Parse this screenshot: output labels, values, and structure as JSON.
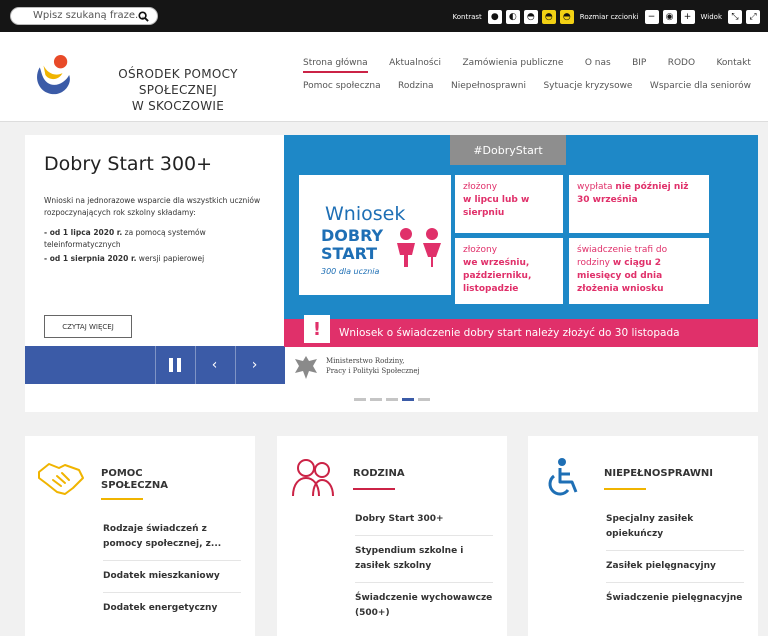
{
  "topbar": {
    "search_placeholder": "Wpisz szukaną fraze...",
    "contrast_label": "Kontrast",
    "font_size_label": "Rozmiar czcionki",
    "view_label": "Widok"
  },
  "header": {
    "org_name_line1": "OŚRODEK POMOCY SPOŁECZNEJ",
    "org_name_line2": "W SKOCZOWIE"
  },
  "nav": {
    "row1": [
      "Strona główna",
      "Aktualności",
      "Zamówienia publiczne",
      "O nas",
      "BIP",
      "RODO",
      "Kontakt"
    ],
    "row2": [
      "Pomoc społeczna",
      "Rodzina",
      "Niepełnosprawni",
      "Sytuacje kryzysowe",
      "Wsparcie dla seniorów"
    ],
    "active": "Strona główna"
  },
  "hero": {
    "title": "Dobry Start 300+",
    "intro": "Wnioski na jednorazowe wsparcie dla wszystkich uczniów rozpoczynających rok szkolny składamy:",
    "item1_bold": "- od 1 lipca 2020 r.",
    "item1_rest": " za pomocą systemów teleinformatycznych",
    "item2_bold": "- od 1 sierpnia 2020 r.",
    "item2_rest": " wersji papierowej",
    "read_more": "CZYTAJ WIĘCEJ"
  },
  "banner": {
    "tag": "#DobryStart",
    "wniosek": "Wniosek",
    "dobry": "DOBRY",
    "start": "START",
    "sub300": "300 dla ucznia",
    "c1_line1": "złożony",
    "c1_bold": "w lipcu lub w sierpniu",
    "c2_line1": "wypłata",
    "c2_bold": "nie później niż 30 września",
    "c3_line1": "złożony",
    "c3_bold": "we wrześniu, październiku, listopadzie",
    "c4_line1": "świadczenie trafi do rodziny",
    "c4_bold": "w ciągu 2 miesięcy od dnia złożenia wniosku",
    "footer": "Wniosek o świadczenie dobry start należy złożyć do 30 listopada",
    "ministry_line1": "Ministerstwo Rodziny,",
    "ministry_line2": "Pracy i Polityki Społecznej"
  },
  "slider": {
    "dot_count": 5,
    "active_dot": 4
  },
  "sections": [
    {
      "title_line1": "POMOC",
      "title_line2": "SPOŁECZNA",
      "icon": "handshake-icon",
      "rule_color": "#f0b400",
      "links": [
        "Rodzaje świadczeń z pomocy społecznej, z...",
        "Dodatek mieszkaniowy",
        "Dodatek energetyczny"
      ]
    },
    {
      "title_line1": "RODZINA",
      "title_line2": "",
      "icon": "family-icon",
      "rule_color": "#cb2346",
      "links": [
        "Dobry Start 300+",
        "Stypendium szkolne i zasiłek szkolny",
        "Świadczenie wychowawcze (500+)"
      ]
    },
    {
      "title_line1": "NIEPEŁNOSPRAWNI",
      "title_line2": "",
      "icon": "wheelchair-icon",
      "rule_color": "#f0b400",
      "links": [
        "Specjalny zasiłek opiekuńczy",
        "Zasiłek pielęgnacyjny",
        "Świadczenie pielęgnacyjne"
      ]
    }
  ],
  "colors": {
    "accent_red": "#cb2346",
    "accent_blue": "#3b5ba7",
    "banner_blue": "#1e88c7",
    "banner_pink": "#e0306a"
  }
}
